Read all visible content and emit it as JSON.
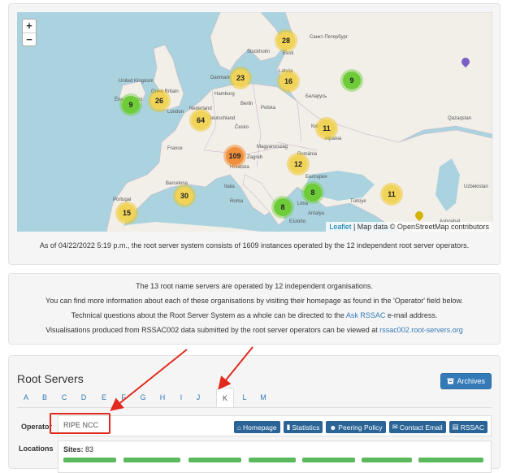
{
  "map": {
    "zoom_in": "+",
    "zoom_out": "−",
    "attribution_link": "Leaflet",
    "attribution_text": " | Map data © OpenStreetMap contributors",
    "clusters": [
      {
        "label": "28",
        "color": "yellow"
      },
      {
        "label": "23",
        "color": "yellow"
      },
      {
        "label": "16",
        "color": "yellow"
      },
      {
        "label": "9",
        "color": "green"
      },
      {
        "label": "9",
        "color": "green"
      },
      {
        "label": "26",
        "color": "yellow"
      },
      {
        "label": "64",
        "color": "yellow"
      },
      {
        "label": "11",
        "color": "yellow"
      },
      {
        "label": "109",
        "color": "orange"
      },
      {
        "label": "12",
        "color": "yellow"
      },
      {
        "label": "30",
        "color": "yellow"
      },
      {
        "label": "8",
        "color": "green"
      },
      {
        "label": "8",
        "color": "green"
      },
      {
        "label": "11",
        "color": "yellow"
      },
      {
        "label": "15",
        "color": "yellow"
      }
    ],
    "place_labels": [
      "Stockholm",
      "Санкт-Петербург",
      "Eesti",
      "Latvija",
      "Danmark",
      "United Kingdom",
      "Great Britain",
      "Éire / Ireland",
      "London",
      "Nederland",
      "Hamburg",
      "Berlin",
      "Deutschland",
      "Беларусь",
      "Polska",
      "Česko",
      "Київ",
      "Україна",
      "France",
      "Magyarország",
      "România",
      "Zagreb",
      "Hrvatska",
      "България",
      "Barcelona",
      "Portugal",
      "Roma",
      "Italia",
      "Ελλάδα",
      "Lima",
      "Türkiye",
      "Antalya",
      "Uzbekistan",
      "Ashgabat",
      "Qazaqstan"
    ]
  },
  "instances_text": "As of 04/22/2022 5:19 p.m., the root server system consists of 1609 instances operated by the 12 independent root server operators.",
  "info": {
    "line1": "The 13 root name servers are operated by 12 independent organisations.",
    "line2": "You can find more information about each of these organisations by visiting their homepage as found in the 'Operator' field below.",
    "line3_pre": "Technical questions about the Root Server System as a whole can be directed to the ",
    "line3_link": "Ask RSSAC",
    "line3_post": " e-mail address.",
    "line4_pre": "Visualisations produced from RSSAC002 data submitted by the root server operators can be viewed at ",
    "line4_link": "rssac002.root-servers.org"
  },
  "servers": {
    "title": "Root Servers",
    "archives_label": "Archives",
    "letters": [
      "A",
      "B",
      "C",
      "D",
      "E",
      "F",
      "G",
      "H",
      "I",
      "J",
      "K",
      "L",
      "M"
    ],
    "active_letter": "K",
    "operator_label": "Operator",
    "operator_name": "RIPE NCC",
    "buttons": {
      "homepage": "Homepage",
      "statistics": "Statistics",
      "peering": "Peering Policy",
      "contact": "Contact Email",
      "rssac": "RSSAC"
    },
    "locations_label": "Locations",
    "sites_label": "Sites:",
    "sites_value": "83"
  },
  "colors": {
    "accent": "#337ab7",
    "annotation": "#e02a1d"
  }
}
